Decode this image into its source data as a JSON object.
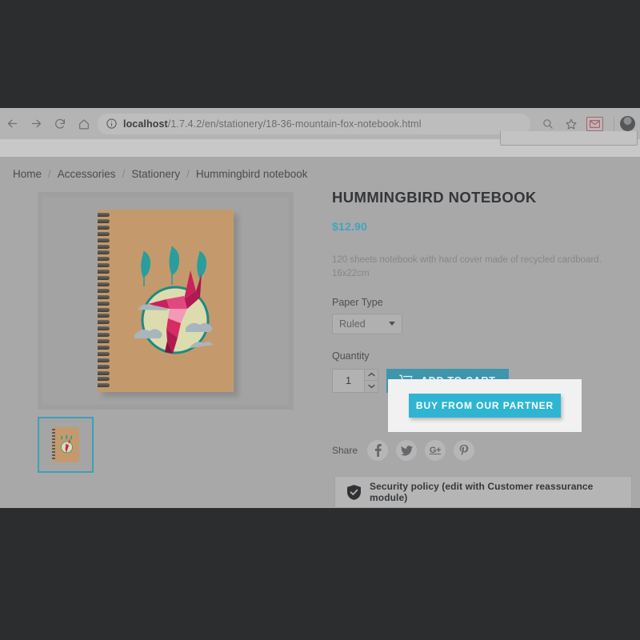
{
  "browser": {
    "url_host": "localhost",
    "url_path": "/1.7.4.2/en/stationery/18-36-mountain-fox-notebook.html",
    "back_icon": "back-arrow-icon",
    "forward_icon": "forward-arrow-icon",
    "reload_icon": "reload-icon",
    "home_icon": "home-icon",
    "info_icon": "site-info-icon",
    "search_icon": "search-icon",
    "bookmark_icon": "star-icon",
    "extension_icon": "extension-icon",
    "profile_icon": "profile-avatar-icon"
  },
  "breadcrumb": {
    "separator": "/",
    "items": [
      {
        "label": "Home"
      },
      {
        "label": "Accessories"
      },
      {
        "label": "Stationery"
      },
      {
        "label": "Hummingbird notebook"
      }
    ]
  },
  "product": {
    "title": "HUMMINGBIRD NOTEBOOK",
    "price": "$12.90",
    "description": "120 sheets notebook with hard cover made of recycled cardboard. 16x22cm",
    "paper_type_label": "Paper Type",
    "paper_type_value": "Ruled",
    "paper_type_options": [
      "Ruled"
    ],
    "quantity_label": "Quantity",
    "quantity_value": "1",
    "add_to_cart_label": "ADD TO CART",
    "partner_button_label": "BUY FROM OUR PARTNER"
  },
  "share": {
    "label": "Share",
    "networks": [
      {
        "name": "facebook",
        "glyph": "f"
      },
      {
        "name": "twitter",
        "glyph": ""
      },
      {
        "name": "google-plus",
        "glyph": "G+"
      },
      {
        "name": "pinterest",
        "glyph": ""
      }
    ]
  },
  "policy": {
    "icon": "shield-check-icon",
    "text": "Security policy (edit with Customer reassurance module)"
  },
  "colors": {
    "accent_teal": "#2fb5d2",
    "price_blue": "#42a4c0",
    "thumb_active_border": "#3f9fb8",
    "letterbox": "#2b2d2e",
    "page_bg": "#a8a8a8",
    "highlight_card": "#f1f1f1",
    "notebook_cover": "#c49a6c"
  }
}
